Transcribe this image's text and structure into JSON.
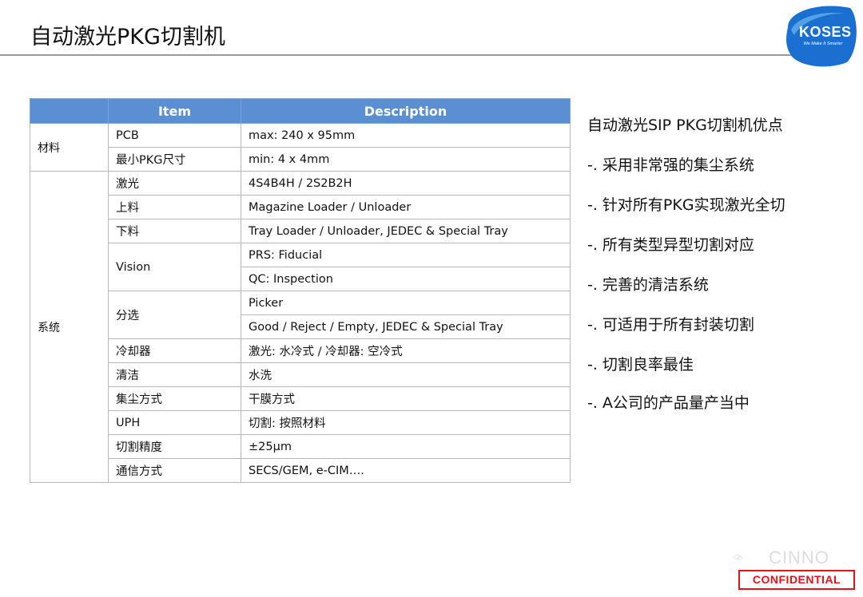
{
  "title": "自动激光PKG切割机",
  "logo": {
    "name": "KOSES",
    "tagline": "We Make It Smarter",
    "color": "#1a6fd1"
  },
  "table": {
    "headers": [
      "",
      "Item",
      "Description"
    ],
    "groups": {
      "material": "材料",
      "system": "系统"
    },
    "rows": [
      {
        "item": "PCB",
        "desc": "max: 240 x 95mm"
      },
      {
        "item": "最小PKG尺寸",
        "desc": "min: 4 x 4mm"
      },
      {
        "item": "激光",
        "desc": "4S4B4H / 2S2B2H"
      },
      {
        "item": "上料",
        "desc": "Magazine Loader / Unloader"
      },
      {
        "item": "下料",
        "desc": "Tray Loader / Unloader, JEDEC & Special Tray"
      },
      {
        "item": "Vision",
        "desc": "PRS: Fiducial",
        "desc2": "QC: Inspection"
      },
      {
        "item": "分选",
        "desc": "Picker",
        "desc2": "Good / Reject / Empty, JEDEC & Special Tray"
      },
      {
        "item": "冷却器",
        "desc": "激光: 水冷式 / 冷却器: 空冷式"
      },
      {
        "item": "清洁",
        "desc": "水洗"
      },
      {
        "item": "集尘方式",
        "desc": "干膜方式"
      },
      {
        "item": "UPH",
        "desc": "切割: 按照材料"
      },
      {
        "item": "切割精度",
        "desc": "±25μm"
      },
      {
        "item": "通信方式",
        "desc": "SECS/GEM, e-CIM…."
      }
    ],
    "header_color": "#5b8fd4"
  },
  "advantages": {
    "title": "自动激光SIP PKG切割机优点",
    "items": [
      "-. 采用非常强的集尘系统",
      "-. 针对所有PKG实现激光全切",
      "-. 所有类型异型切割对应",
      "-. 完善的清洁系统",
      "-. 可适用于所有封装切割",
      "-. 切割良率最佳",
      "-. A公司的产品量产当中"
    ]
  },
  "watermark": "CINNO",
  "confidential": "CONFIDENTIAL",
  "confidential_color": "#e3121b"
}
